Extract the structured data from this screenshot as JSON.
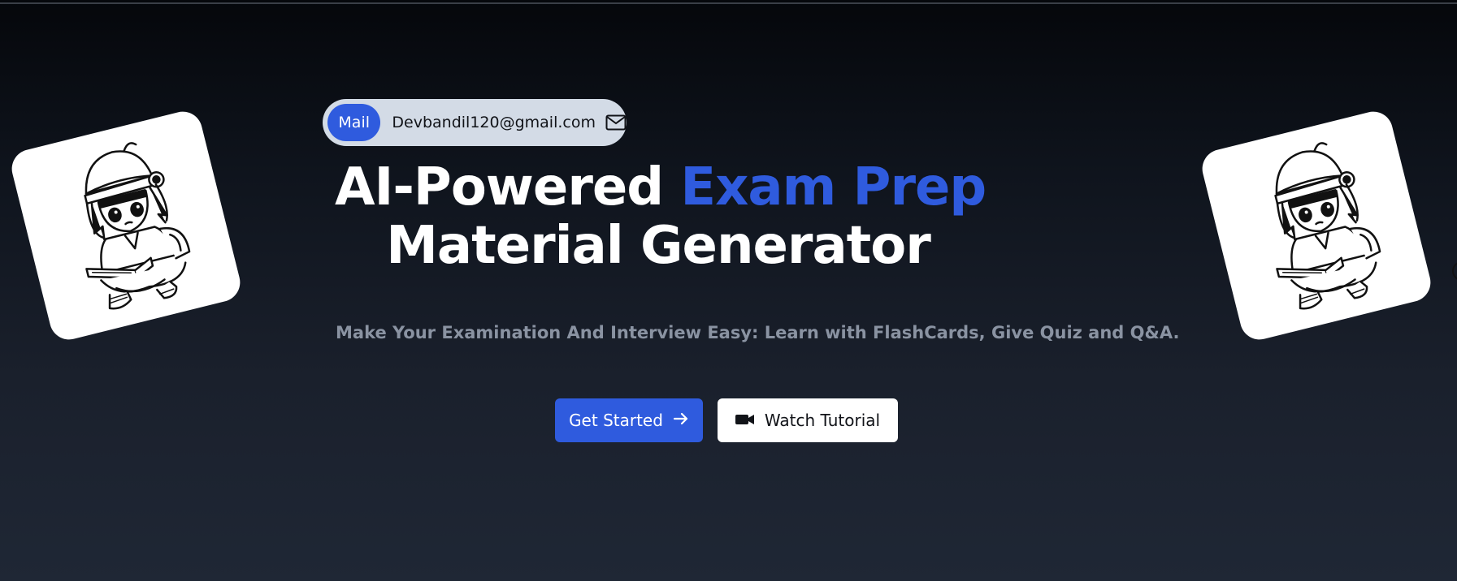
{
  "mail": {
    "badge_label": "Mail",
    "address": "Devbandil120@gmail.com",
    "icon": "envelope-icon"
  },
  "hero": {
    "title_part1": "AI-Powered ",
    "title_accent": "Exam Prep",
    "title_line2": "Material Generator",
    "subtitle": "Make Your Examination And Interview Easy: Learn with FlashCards, Give Quiz and Q&A."
  },
  "actions": {
    "get_started_label": "Get Started",
    "get_started_icon": "arrow-right-icon",
    "watch_tutorial_label": "Watch Tutorial",
    "watch_tutorial_icon": "video-camera-icon"
  },
  "illustration": {
    "description": "anime-student-reading-book"
  },
  "colors": {
    "accent": "#2f5bde",
    "background_top": "#05070b",
    "background_bottom": "#1f2735",
    "subtitle": "#8a93a2",
    "pill_bg": "#d3dbe6"
  }
}
